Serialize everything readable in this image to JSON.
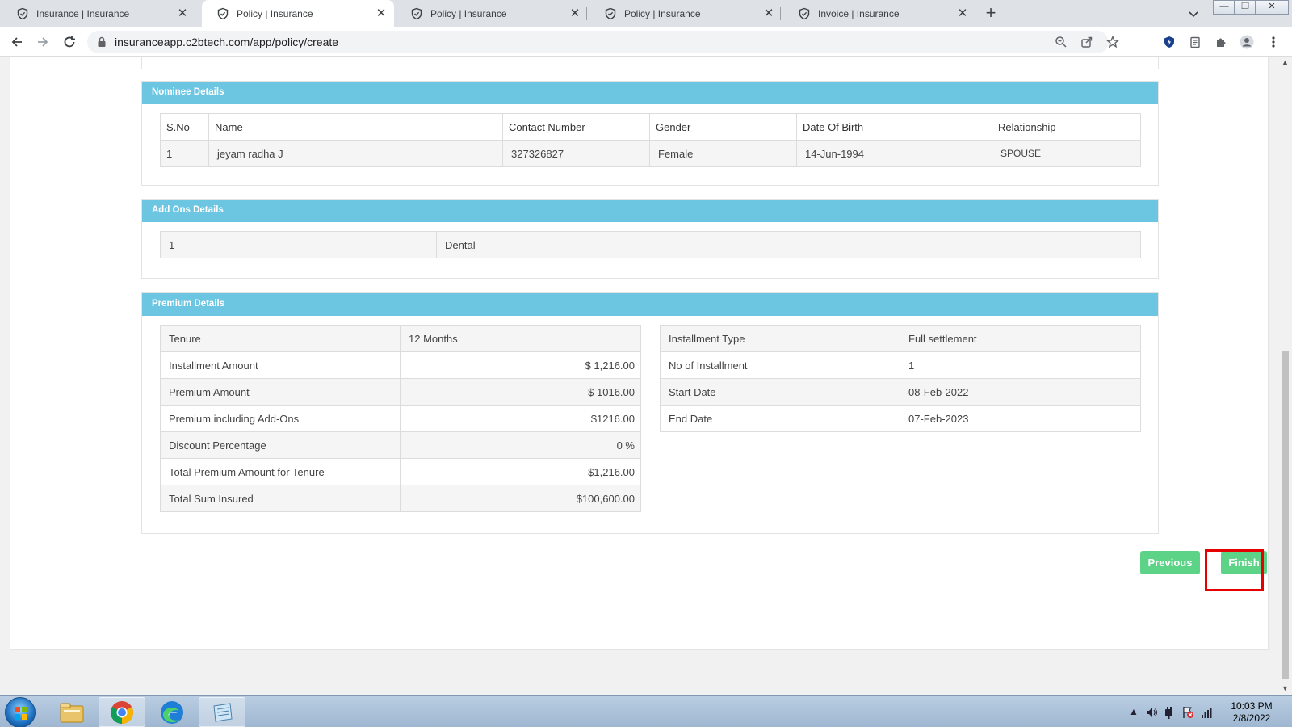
{
  "browser": {
    "tabs": [
      {
        "title": "Insurance | Insurance",
        "active": false
      },
      {
        "title": "Policy | Insurance",
        "active": true
      },
      {
        "title": "Policy | Insurance",
        "active": false
      },
      {
        "title": "Policy | Insurance",
        "active": false
      },
      {
        "title": "Invoice | Insurance",
        "active": false
      }
    ],
    "url": "insuranceapp.c2btech.com/app/policy/create"
  },
  "nominee": {
    "title": "Nominee Details",
    "headers": [
      "S.No",
      "Name",
      "Contact Number",
      "Gender",
      "Date Of Birth",
      "Relationship"
    ],
    "rows": [
      [
        "1",
        "jeyam radha J",
        "327326827",
        "Female",
        "14-Jun-1994",
        "SPOUSE"
      ]
    ]
  },
  "addons": {
    "title": "Add Ons Details",
    "rows": [
      [
        "1",
        "Dental"
      ]
    ]
  },
  "premium": {
    "title": "Premium Details",
    "left": [
      [
        "Tenure",
        "12 Months"
      ],
      [
        "Installment Amount",
        "$ 1,216.00"
      ],
      [
        "Premium Amount",
        "$ 1016.00"
      ],
      [
        "Premium including Add-Ons",
        "$1216.00"
      ],
      [
        "Discount Percentage",
        "0 %"
      ],
      [
        "Total Premium Amount for Tenure",
        "$1,216.00"
      ],
      [
        "Total Sum Insured",
        "$100,600.00"
      ]
    ],
    "right": [
      [
        "Installment Type",
        "Full settlement"
      ],
      [
        "No of Installment",
        "1"
      ],
      [
        "Start Date",
        "08-Feb-2022"
      ],
      [
        "End Date",
        "07-Feb-2023"
      ]
    ]
  },
  "actions": {
    "previous_label": "Previous",
    "finish_label": "Finish",
    "accent": "#5cd387",
    "highlight": "#e60000"
  },
  "taskbar": {
    "time": "10:03 PM",
    "date": "2/8/2022"
  },
  "colors": {
    "section_header": "#6cc6e2"
  }
}
